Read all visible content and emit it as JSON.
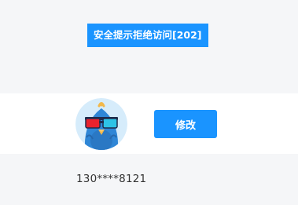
{
  "alert": {
    "text": "安全提示拒绝访问[202]"
  },
  "profile": {
    "avatar_icon": "cartoon-bird-3d-glasses-avatar",
    "edit_label": "修改",
    "phone_masked": "130****8121"
  },
  "colors": {
    "accent": "#1a94ff",
    "background": "#f5f6f8",
    "row_background": "#ffffff",
    "text": "#333333"
  }
}
